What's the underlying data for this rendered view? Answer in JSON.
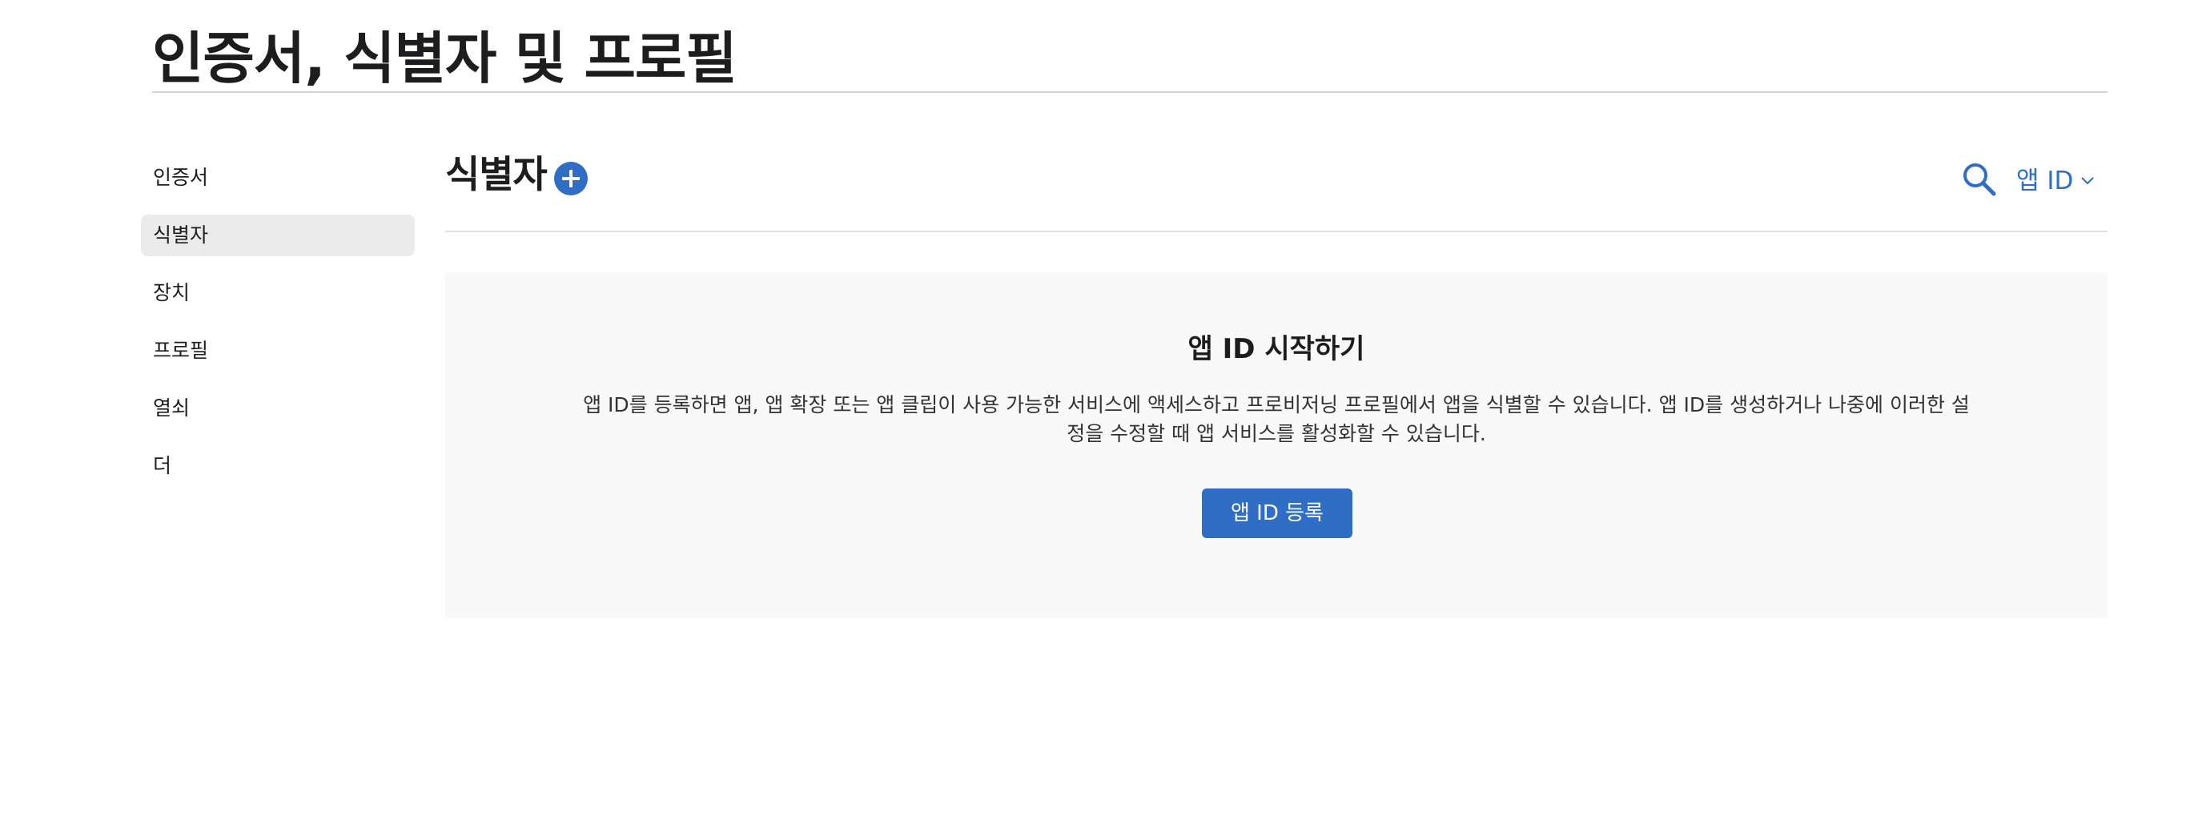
{
  "header": {
    "title": "인증서, 식별자 및 프로필"
  },
  "sidebar": {
    "items": [
      {
        "label": "인증서",
        "active": false
      },
      {
        "label": "식별자",
        "active": true
      },
      {
        "label": "장치",
        "active": false
      },
      {
        "label": "프로필",
        "active": false
      },
      {
        "label": "열쇠",
        "active": false
      },
      {
        "label": "더",
        "active": false
      }
    ]
  },
  "main": {
    "section_title": "식별자",
    "filter": {
      "selected": "앱 ID"
    },
    "empty_state": {
      "title": "앱 ID 시작하기",
      "description": "앱 ID를 등록하면 앱, 앱 확장 또는 앱 클립이 사용 가능한 서비스에 액세스하고 프로비저닝 프로필에서 앱을 식별할 수 있습니다. 앱 ID를 생성하거나 나중에 이러한 설정을 수정할 때 앱 서비스를 활성화할 수 있습니다.",
      "button_label": "앱 ID 등록"
    }
  },
  "icons": {
    "add": "plus-circle-icon",
    "search": "search-icon",
    "dropdown": "chevron-down-icon"
  },
  "colors": {
    "accent": "#2f6ec4",
    "sidebar_active_bg": "#ebebeb",
    "panel_bg": "#f9f9f9"
  }
}
